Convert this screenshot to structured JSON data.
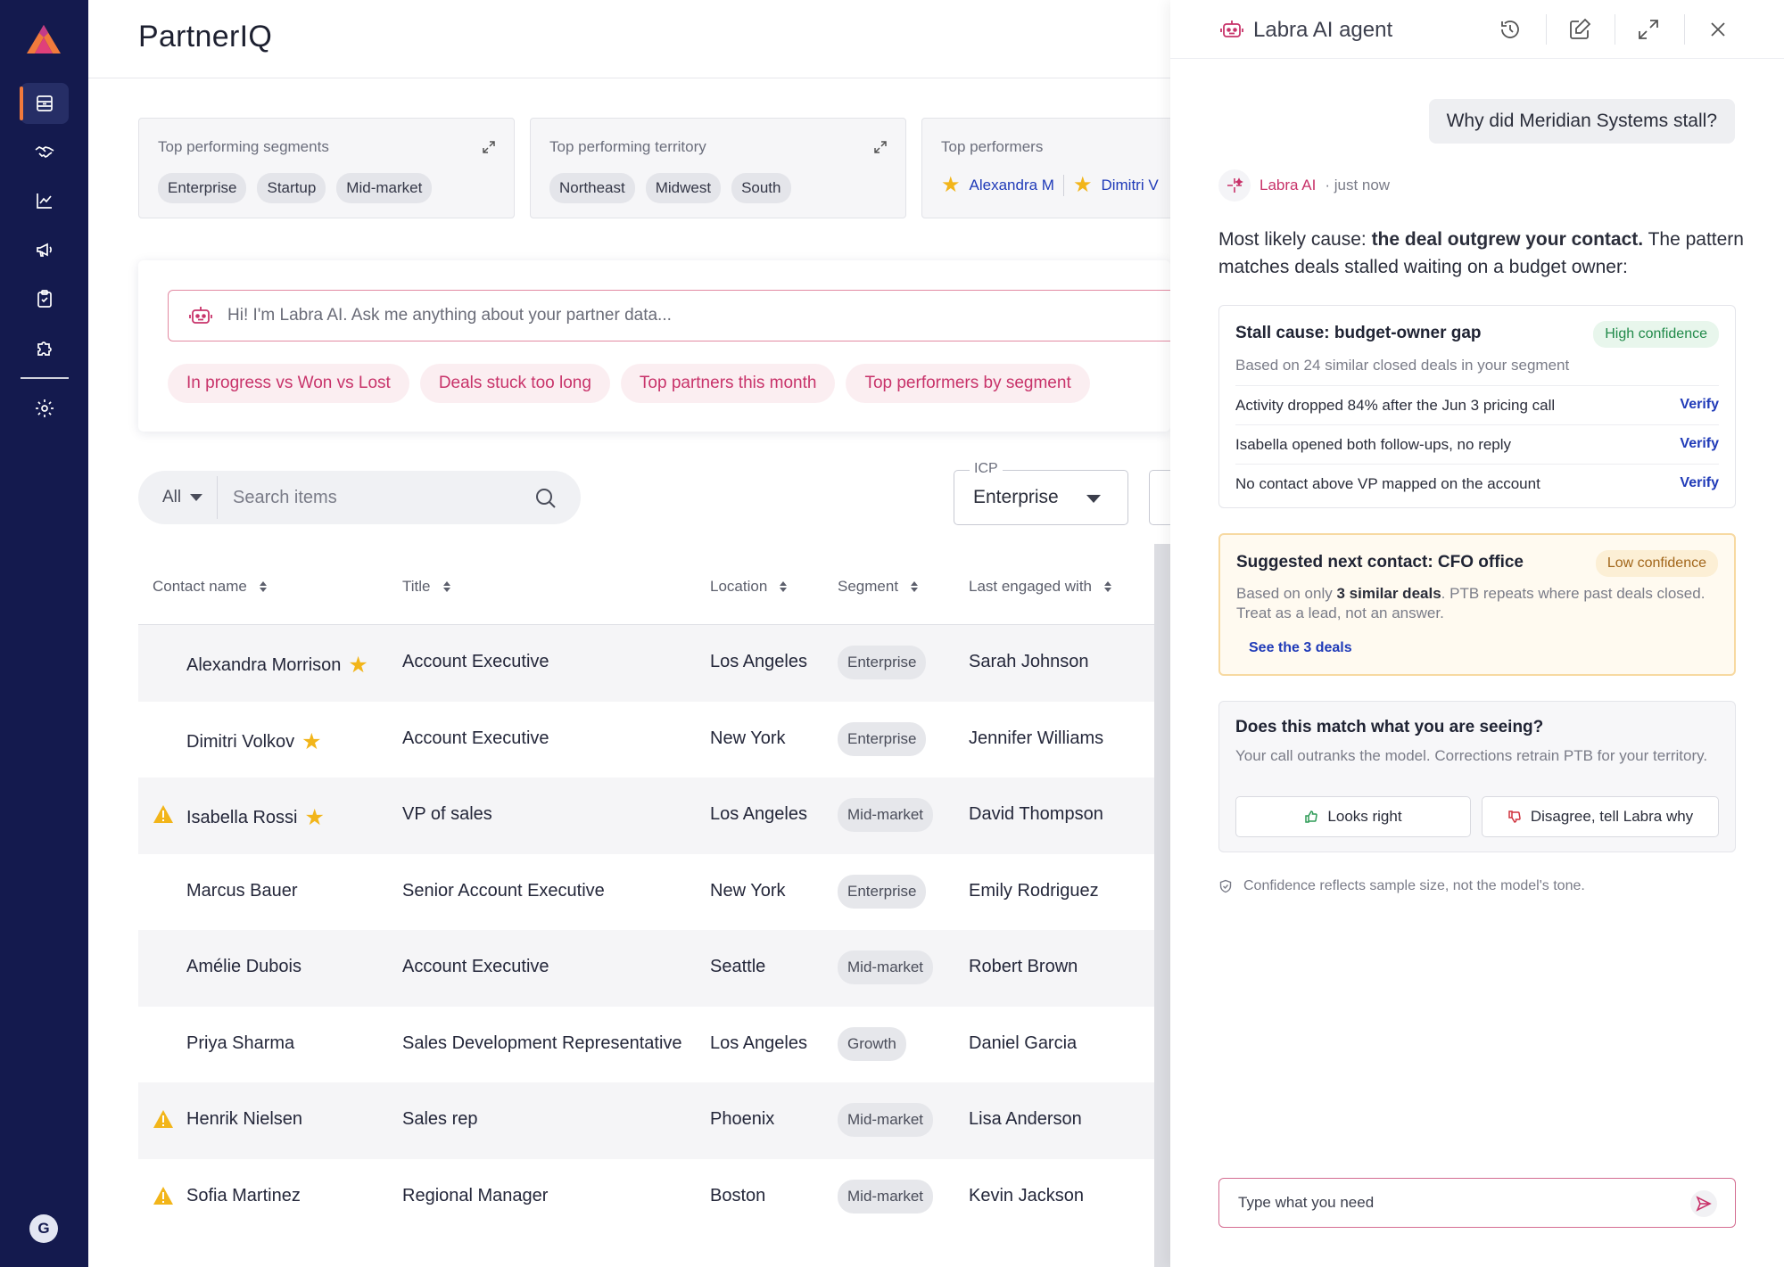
{
  "app": {
    "title": "PartnerIQ"
  },
  "sidebar": {
    "items": [
      {
        "icon": "inbox-icon",
        "active": true
      },
      {
        "icon": "handshake-icon",
        "active": false
      },
      {
        "icon": "chart-line-icon",
        "active": false
      },
      {
        "icon": "megaphone-icon",
        "active": false
      },
      {
        "icon": "clipboard-icon",
        "active": false
      },
      {
        "icon": "puzzle-icon",
        "active": false
      },
      {
        "icon": "gear-icon",
        "active": false
      }
    ],
    "avatar_initial": "G",
    "accent": "#f17a3c",
    "background": "#141a4e"
  },
  "cards": {
    "segments": {
      "title": "Top performing segments",
      "chips": [
        "Enterprise",
        "Startup",
        "Mid-market"
      ]
    },
    "territory": {
      "title": "Top performing territory",
      "chips": [
        "Northeast",
        "Midwest",
        "South"
      ]
    },
    "performers": {
      "title": "Top performers",
      "names": [
        "Alexandra M",
        "Dimitri V"
      ]
    }
  },
  "ai_prompt": {
    "placeholder": "Hi! I'm Labra AI. Ask me anything about your partner data...",
    "suggestions": [
      "In progress vs Won vs Lost",
      "Deals stuck too long",
      "Top partners this month",
      "Top performers by segment"
    ]
  },
  "filters": {
    "scope": "All",
    "search_placeholder": "Search items",
    "icp_label": "ICP",
    "icp_value": "Enterprise"
  },
  "table": {
    "columns": [
      "Contact name",
      "Title",
      "Location",
      "Segment",
      "Last engaged with"
    ],
    "rows": [
      {
        "name": "Alexandra Morrison",
        "star": true,
        "warn": false,
        "title": "Account Executive",
        "location": "Los Angeles",
        "segment": "Enterprise",
        "last": "Sarah Johnson"
      },
      {
        "name": "Dimitri Volkov",
        "star": true,
        "warn": false,
        "title": "Account Executive",
        "location": "New York",
        "segment": "Enterprise",
        "last": "Jennifer Williams"
      },
      {
        "name": "Isabella Rossi",
        "star": true,
        "warn": true,
        "title": "VP of sales",
        "location": "Los Angeles",
        "segment": "Mid-market",
        "last": "David Thompson"
      },
      {
        "name": "Marcus Bauer",
        "star": false,
        "warn": false,
        "title": "Senior Account Executive",
        "location": "New York",
        "segment": "Enterprise",
        "last": "Emily Rodriguez"
      },
      {
        "name": "Amélie Dubois",
        "star": false,
        "warn": false,
        "title": "Account Executive",
        "location": "Seattle",
        "segment": "Mid-market",
        "last": "Robert Brown"
      },
      {
        "name": "Priya Sharma",
        "star": false,
        "warn": false,
        "title": "Sales Development Representative",
        "location": "Los Angeles",
        "segment": "Growth",
        "last": "Daniel Garcia"
      },
      {
        "name": "Henrik Nielsen",
        "star": false,
        "warn": true,
        "title": "Sales rep",
        "location": "Phoenix",
        "segment": "Mid-market",
        "last": "Lisa Anderson"
      },
      {
        "name": "Sofia Martinez",
        "star": false,
        "warn": true,
        "title": "Regional Manager",
        "location": "Boston",
        "segment": "Mid-market",
        "last": "Kevin Jackson"
      }
    ]
  },
  "agent": {
    "title": "Labra AI agent",
    "user_question": "Why did Meridian Systems stall?",
    "ai_name": "Labra AI",
    "ai_time": "· just now",
    "answer_prefix": "Most likely cause: ",
    "answer_bold": "the deal outgrew your contact.",
    "answer_suffix": " The pattern matches deals stalled waiting on a budget owner:",
    "stall": {
      "title": "Stall cause: budget-owner gap",
      "confidence": "High confidence",
      "basis": "Based on 24 similar closed deals in your segment",
      "evidence": [
        {
          "text": "Activity dropped 84% after the Jun 3 pricing call",
          "action": "Verify"
        },
        {
          "text": "Isabella opened both follow-ups, no reply",
          "action": "Verify"
        },
        {
          "text": "No contact above VP mapped on the account",
          "action": "Verify"
        }
      ]
    },
    "next_contact": {
      "title": "Suggested next contact: CFO office",
      "confidence": "Low confidence",
      "text_prefix": "Based on only ",
      "text_bold": "3 similar deals",
      "text_suffix": ". PTB repeats where past deals closed. Treat as a lead, not an answer.",
      "link": "See the 3 deals"
    },
    "feedback": {
      "title": "Does this match what you are seeing?",
      "text": "Your call outranks the model. Corrections retrain PTB for your territory.",
      "agree": "Looks right",
      "disagree": "Disagree, tell Labra why"
    },
    "note": "Confidence reflects sample size, not the model's tone.",
    "input_placeholder": "Type what you need"
  }
}
